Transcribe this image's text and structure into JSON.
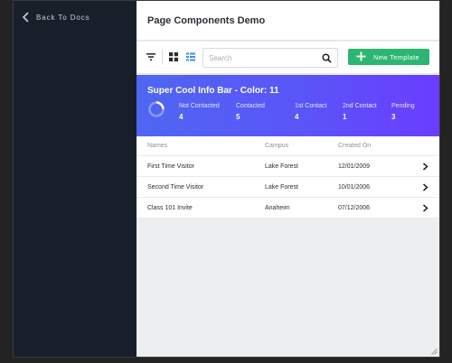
{
  "sidebar": {
    "back_label": "Back To Docs"
  },
  "header": {
    "title": "Page Components Demo"
  },
  "toolbar": {
    "icons": [
      "filter-icon",
      "grid-view-icon",
      "list-view-icon"
    ],
    "search_placeholder": "Search",
    "search_value": "",
    "new_button_label": "New Template"
  },
  "infobar": {
    "title": "Super Cool Info Bar - Color: 11",
    "stats": [
      {
        "label": "Not Contacted",
        "value": "4"
      },
      {
        "label": "Contacted",
        "value": "5"
      },
      {
        "label": "1st Contact",
        "value": "4"
      },
      {
        "label": "2nd Contact",
        "value": "1"
      },
      {
        "label": "Pending",
        "value": "3"
      }
    ]
  },
  "table": {
    "columns": [
      "Names",
      "Campus",
      "Created On"
    ],
    "rows": [
      {
        "name": "First Time Visitor",
        "campus": "Lake Forest",
        "created": "12/01/2009"
      },
      {
        "name": "Second Time Visitor",
        "campus": "Lake Forest",
        "created": "10/01/2006"
      },
      {
        "name": "Class 101 Invite",
        "campus": "Anaheim",
        "created": "07/12/2006"
      }
    ]
  },
  "colors": {
    "sidebar": "#17202a",
    "accent_green": "#2bb673",
    "infobar_start": "#4f66f2",
    "infobar_end": "#6a3cff",
    "active_view": "#3b8fe0"
  }
}
